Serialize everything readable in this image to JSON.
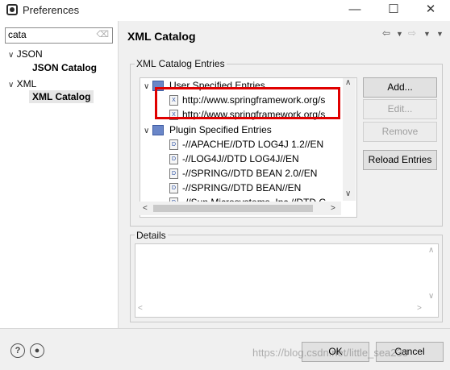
{
  "window": {
    "title": "Preferences",
    "minimize_glyph": "☐",
    "close_glyph": "✕"
  },
  "filter": {
    "value": "cata"
  },
  "tree": {
    "groups": [
      {
        "label": "JSON",
        "child": "JSON Catalog"
      },
      {
        "label": "XML",
        "child": "XML Catalog"
      }
    ]
  },
  "page": {
    "title": "XML Catalog"
  },
  "catalog": {
    "group_label": "XML Catalog Entries",
    "user_group": "User Specified Entries",
    "user_entries": [
      "http://www.springframework.org/s",
      "http://www.springframework.org/s"
    ],
    "plugin_group": "Plugin Specified Entries",
    "plugin_entries": [
      "-//APACHE//DTD LOG4J 1.2//EN",
      "-//LOG4J//DTD LOG4J//EN",
      "-//SPRING//DTD BEAN 2.0//EN",
      "-//SPRING//DTD BEAN//EN",
      "-//Sun Microsystems, Inc.//DTD C"
    ]
  },
  "buttons": {
    "add": "Add...",
    "edit": "Edit...",
    "remove": "Remove",
    "reload": "Reload Entries"
  },
  "details": {
    "label": "Details"
  },
  "footer": {
    "ok": "OK",
    "cancel": "Cancel",
    "help_glyph": "?",
    "watermark": "https://blog.csdn.net/little_sea233"
  }
}
